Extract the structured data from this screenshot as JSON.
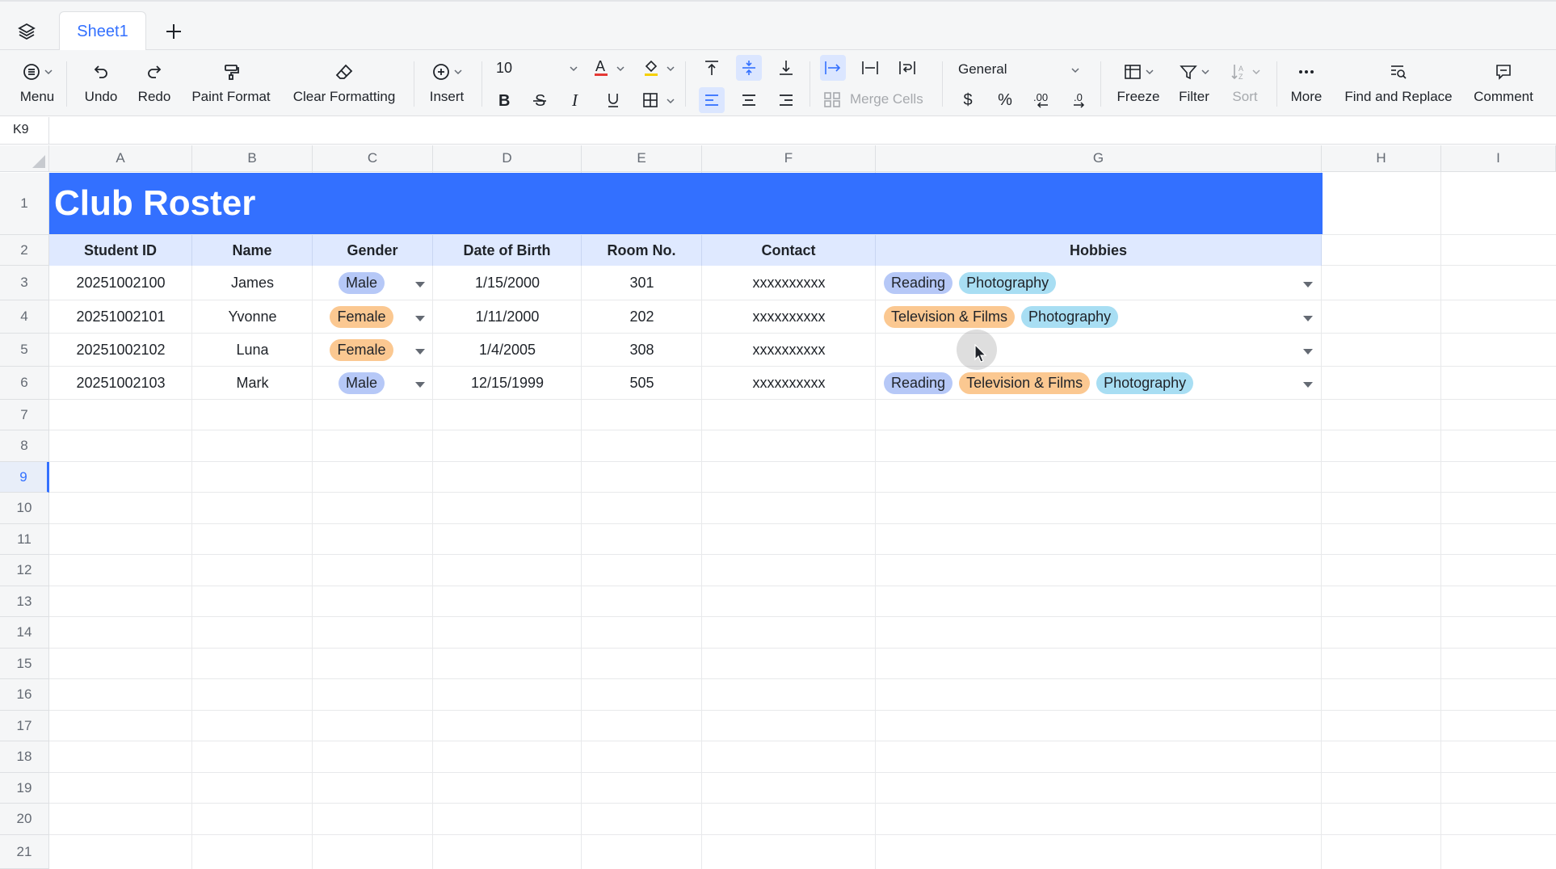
{
  "tabs": {
    "sheet_name": "Sheet1",
    "add_label": "+"
  },
  "toolbar": {
    "menu": "Menu",
    "undo": "Undo",
    "redo": "Redo",
    "paint_format": "Paint Format",
    "clear_formatting": "Clear Formatting",
    "insert": "Insert",
    "font_size": "10",
    "merge_cells": "Merge Cells",
    "number_format": "General",
    "currency": "$",
    "percent": "%",
    "freeze": "Freeze",
    "filter": "Filter",
    "sort": "Sort",
    "more": "More",
    "find_replace": "Find and Replace",
    "comment": "Comment"
  },
  "formula_bar": {
    "cell_ref": "K9"
  },
  "columns": [
    "A",
    "B",
    "C",
    "D",
    "E",
    "F",
    "G",
    "H",
    "I"
  ],
  "rows": [
    "1",
    "2",
    "3",
    "4",
    "5",
    "6",
    "7",
    "8",
    "9",
    "10",
    "11",
    "12",
    "13",
    "14",
    "15",
    "16",
    "17",
    "18",
    "19",
    "20",
    "21"
  ],
  "selected_row": "9",
  "sheet": {
    "title": "Club Roster",
    "headers": [
      "Student ID",
      "Name",
      "Gender",
      "Date of Birth",
      "Room No.",
      "Contact",
      "Hobbies"
    ],
    "records": [
      {
        "id": "20251002100",
        "name": "James",
        "gender": "Male",
        "dob": "1/15/2000",
        "room": "301",
        "contact": "xxxxxxxxxx",
        "hobbies": [
          "Reading",
          "Photography"
        ]
      },
      {
        "id": "20251002101",
        "name": "Yvonne",
        "gender": "Female",
        "dob": "1/11/2000",
        "room": "202",
        "contact": "xxxxxxxxxx",
        "hobbies": [
          "Television & Films",
          "Photography"
        ]
      },
      {
        "id": "20251002102",
        "name": "Luna",
        "gender": "Female",
        "dob": "1/4/2005",
        "room": "308",
        "contact": "xxxxxxxxxx",
        "hobbies": []
      },
      {
        "id": "20251002103",
        "name": "Mark",
        "gender": "Male",
        "dob": "12/15/1999",
        "room": "505",
        "contact": "xxxxxxxxxx",
        "hobbies": [
          "Reading",
          "Television & Films",
          "Photography"
        ]
      }
    ]
  },
  "colors": {
    "accent": "#3370ff",
    "title_band": "#3370ff",
    "header_fill": "#dfe9ff",
    "tag_male": "#b6c8f7",
    "tag_female": "#fbc891",
    "tag_reading": "#b6c8f7",
    "tag_tv": "#fbc891",
    "tag_photography": "#a8def3"
  }
}
